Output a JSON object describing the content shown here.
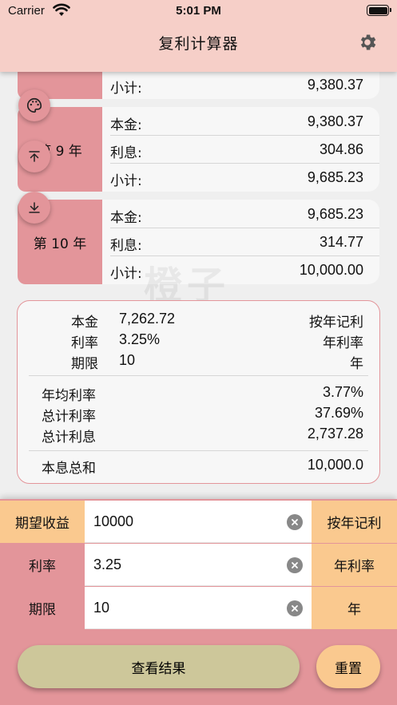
{
  "status": {
    "carrier": "Carrier",
    "time": "5:01 PM"
  },
  "nav": {
    "title": "复利计算器"
  },
  "years": {
    "prev_subtotal_label": "小计:",
    "prev_subtotal": "9,380.37",
    "y9": {
      "label": "第 9 年",
      "principal_label": "本金:",
      "principal": "9,380.37",
      "interest_label": "利息:",
      "interest": "304.86",
      "subtotal_label": "小计:",
      "subtotal": "9,685.23"
    },
    "y10": {
      "label": "第 10 年",
      "principal_label": "本金:",
      "principal": "9,685.23",
      "interest_label": "利息:",
      "interest": "314.77",
      "subtotal_label": "小计:",
      "subtotal": "10,000.00"
    }
  },
  "watermark": "橙子",
  "summary": {
    "principal_label": "本金",
    "principal": "7,262.72",
    "mode": "按年记利",
    "rate_label": "利率",
    "rate": "3.25%",
    "rate_type": "年利率",
    "term_label": "期限",
    "term": "10",
    "term_unit": "年",
    "annual_rate_label": "年均利率",
    "annual_rate": "3.77%",
    "total_rate_label": "总计利率",
    "total_rate": "37.69%",
    "total_interest_label": "总计利息",
    "total_interest": "2,737.28",
    "total_sum_label": "本息总和",
    "total_sum": "10,000.0"
  },
  "inputs": {
    "expected": {
      "label": "期望收益",
      "value": "10000",
      "unit": "按年记利"
    },
    "rate": {
      "label": "利率",
      "value": "3.25",
      "unit": "年利率"
    },
    "term": {
      "label": "期限",
      "value": "10",
      "unit": "年"
    }
  },
  "buttons": {
    "view": "查看结果",
    "reset": "重置"
  }
}
